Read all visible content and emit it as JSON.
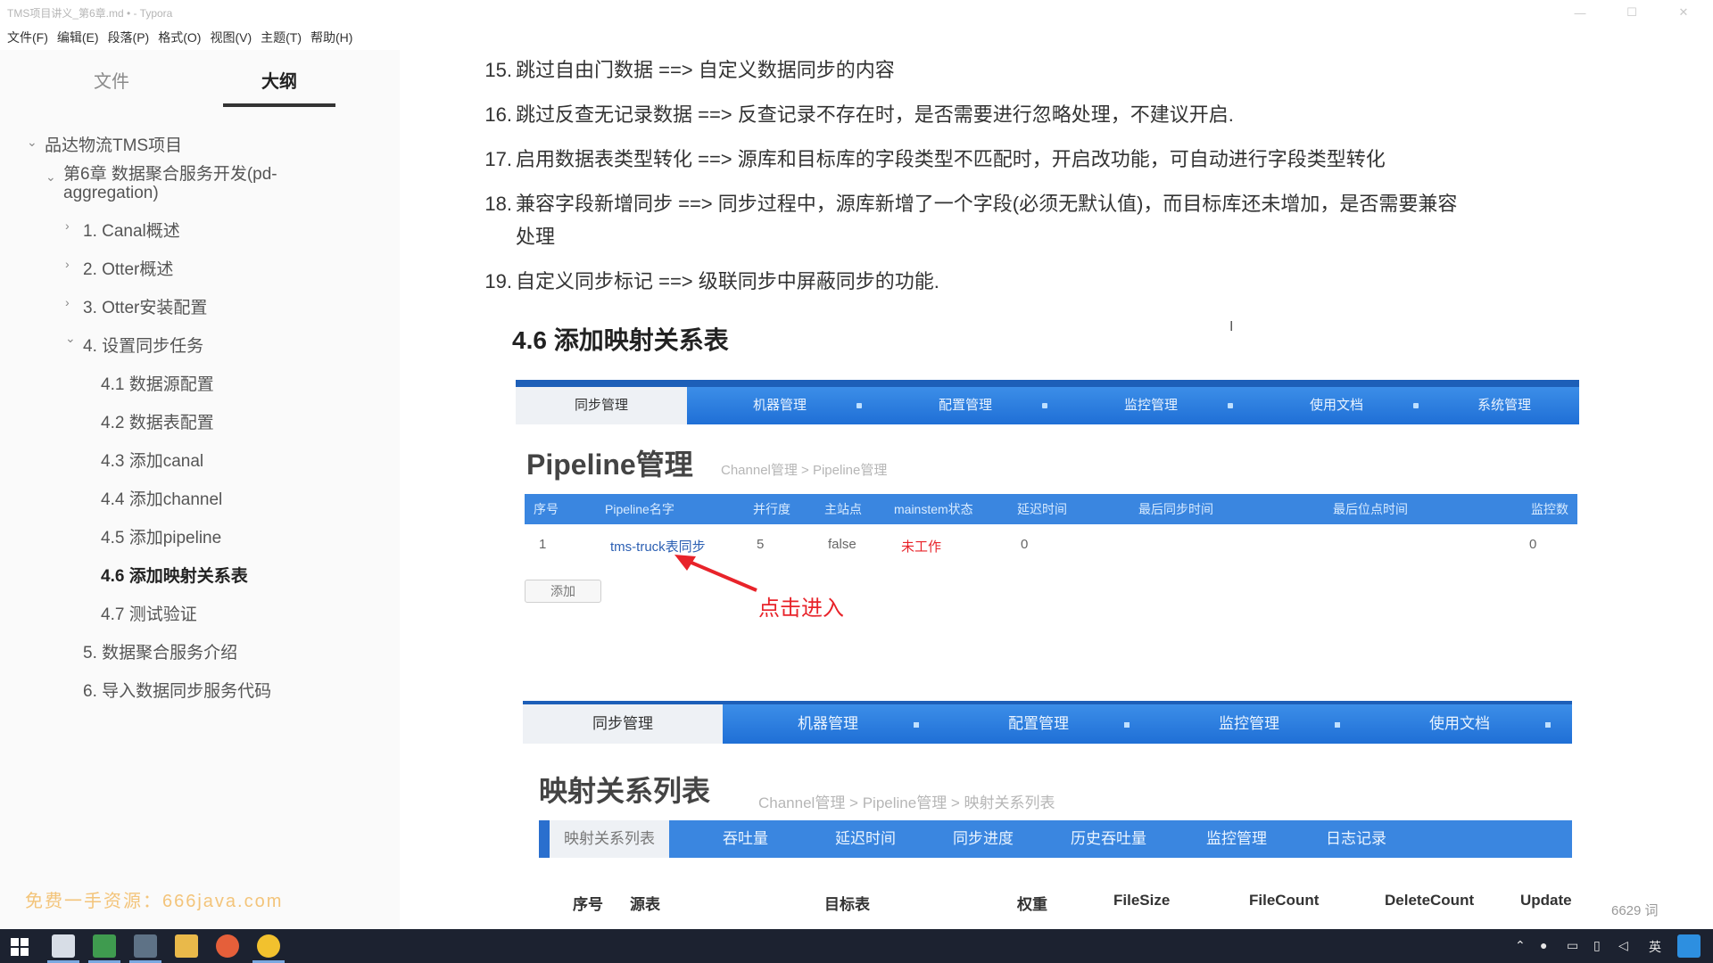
{
  "window": {
    "title": "TMS项目讲义_第6章.md • - Typora",
    "controls": [
      "—",
      "☐",
      "✕"
    ]
  },
  "menubar": [
    "文件(F)",
    "编辑(E)",
    "段落(P)",
    "格式(O)",
    "视图(V)",
    "主题(T)",
    "帮助(H)"
  ],
  "sidebar": {
    "tabs": {
      "files": "文件",
      "outline": "大纲"
    },
    "outline": [
      {
        "label": "品达物流TMS项目"
      },
      {
        "label": "第6章 数据聚合服务开发(pd-"
      },
      {
        "label": "aggregation)"
      },
      {
        "label": "1. Canal概述"
      },
      {
        "label": "2. Otter概述"
      },
      {
        "label": "3. Otter安装配置"
      },
      {
        "label": "4. 设置同步任务"
      },
      {
        "label": "4.1 数据源配置"
      },
      {
        "label": "4.2 数据表配置"
      },
      {
        "label": "4.3 添加canal"
      },
      {
        "label": "4.4 添加channel"
      },
      {
        "label": "4.5 添加pipeline"
      },
      {
        "label": "4.6 添加映射关系表"
      },
      {
        "label": "4.7 测试验证"
      },
      {
        "label": "5. 数据聚合服务介绍"
      },
      {
        "label": "6. 导入数据同步服务代码"
      }
    ],
    "watermark": "免费一手资源：666java.com",
    "footer": {
      "back": "<",
      "source": "</>"
    }
  },
  "editor": {
    "list": [
      {
        "num": "15.",
        "text": "跳过自由门数据 ==> 自定义数据同步的内容"
      },
      {
        "num": "16.",
        "text": "跳过反查无记录数据 ==> 反查记录不存在时，是否需要进行忽略处理，不建议开启."
      },
      {
        "num": "17.",
        "text": "启用数据表类型转化 ==> 源库和目标库的字段类型不匹配时，开启改功能，可自动进行字段类型转化"
      },
      {
        "num": "18.",
        "text": "兼容字段新增同步 ==> 同步过程中，源库新增了一个字段(必须无默认值)，而目标库还未增加，是否需要兼容"
      },
      {
        "num": "",
        "text": "处理"
      },
      {
        "num": "19.",
        "text": "自定义同步标记 ==> 级联同步中屏蔽同步的功能."
      }
    ],
    "heading": "4.6 添加映射关系表",
    "word_count": "6629 词"
  },
  "shot1": {
    "nav": [
      "同步管理",
      "机器管理",
      "配置管理",
      "监控管理",
      "使用文档",
      "系统管理"
    ],
    "title": "Pipeline管理",
    "breadcrumb": "Channel管理 > Pipeline管理",
    "headers": [
      "序号",
      "Pipeline名字",
      "并行度",
      "主站点",
      "mainstem状态",
      "延迟时间",
      "最后同步时间",
      "最后位点时间",
      "监控数"
    ],
    "row": [
      "1",
      "tms-truck表同步",
      "5",
      "false",
      "未工作",
      "0",
      "0"
    ],
    "add_button": "添加",
    "annotation": "点击进入"
  },
  "shot2": {
    "nav": [
      "同步管理",
      "机器管理",
      "配置管理",
      "监控管理",
      "使用文档"
    ],
    "title": "映射关系列表",
    "breadcrumb": "Channel管理 > Pipeline管理 > 映射关系列表",
    "subtabs": [
      "映射关系列表",
      "吞吐量",
      "延迟时间",
      "同步进度",
      "历史吞吐量",
      "监控管理",
      "日志记录"
    ],
    "columns": [
      "序号",
      "源表",
      "目标表",
      "权重",
      "FileSize",
      "FileCount",
      "DeleteCount",
      "Update"
    ]
  },
  "colors": {
    "nav_blue": "#2a7be0",
    "annotation_red": "#e8232a",
    "link_blue": "#2b5fb3"
  },
  "taskbar": {
    "ime": "英",
    "tray_time": ""
  }
}
